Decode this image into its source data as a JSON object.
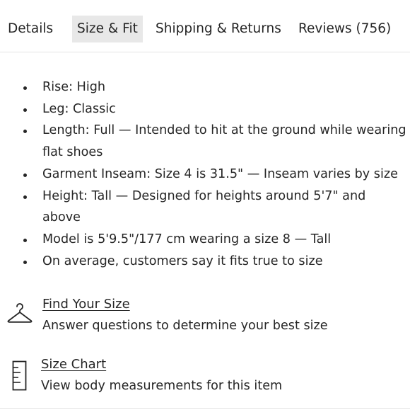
{
  "tabs": [
    {
      "label": "Details",
      "active": false
    },
    {
      "label": "Size & Fit",
      "active": true
    },
    {
      "label": "Shipping & Returns",
      "active": false
    },
    {
      "label": "Reviews (756)",
      "active": false
    }
  ],
  "fit_details": [
    "Rise: High",
    "Leg: Classic",
    "Length: Full — Intended to hit at the ground while wearing flat shoes",
    "Garment Inseam: Size 4 is 31.5\" — Inseam varies by size",
    "Height: Tall — Designed for heights around 5'7\" and above",
    "Model is 5'9.5\"/177 cm wearing a size 8  —  Tall",
    "On average, customers say it fits true to size"
  ],
  "find_your_size": {
    "link": "Find Your Size",
    "description": "Answer questions to determine your best size",
    "icon": "hanger-icon"
  },
  "size_chart": {
    "link": "Size Chart",
    "description": "View body measurements for this item",
    "icon": "ruler-icon"
  },
  "colors": {
    "text": "#262626",
    "active_tab_bg": "#e8e8e8",
    "divider": "#e4e4e4"
  }
}
